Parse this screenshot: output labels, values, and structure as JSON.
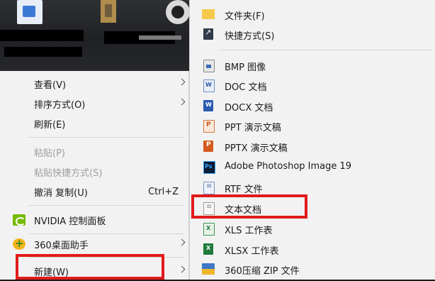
{
  "colors": {
    "menu_bg": "#f2f2f2",
    "highlight": "#e21b1b"
  },
  "desktop": {
    "icons": [
      "document-icon",
      "folder-icon",
      "music-player-icon"
    ]
  },
  "context_menu": {
    "items": [
      {
        "label": "查看(V)",
        "submenu": true
      },
      {
        "label": "排序方式(O)",
        "submenu": true
      },
      {
        "label": "刷新(E)"
      },
      {
        "label": "粘贴(P)",
        "disabled": true
      },
      {
        "label": "粘贴快捷方式(S)",
        "disabled": true
      },
      {
        "label": "撤消 复制(U)",
        "shortcut": "Ctrl+Z"
      },
      {
        "label": "NVIDIA 控制面板",
        "icon": "nvidia-icon"
      },
      {
        "label": "360桌面助手",
        "icon": "360-icon",
        "submenu": true
      },
      {
        "label": "新建(W)",
        "submenu": true,
        "highlighted": true
      }
    ]
  },
  "new_submenu": {
    "items": [
      {
        "label": "文件夹(F)",
        "icon": "folder-icon"
      },
      {
        "label": "快捷方式(S)",
        "icon": "shortcut-icon"
      },
      {
        "label": "BMP 图像",
        "icon": "bmp-file-icon"
      },
      {
        "label": "DOC 文档",
        "icon": "doc-file-icon"
      },
      {
        "label": "DOCX 文档",
        "icon": "docx-file-icon"
      },
      {
        "label": "PPT 演示文稿",
        "icon": "ppt-file-icon"
      },
      {
        "label": "PPTX 演示文稿",
        "icon": "pptx-file-icon"
      },
      {
        "label": "Adobe Photoshop Image 19",
        "icon": "photoshop-file-icon"
      },
      {
        "label": "RTF 文件",
        "icon": "rtf-file-icon"
      },
      {
        "label": "文本文档",
        "icon": "text-file-icon",
        "highlighted": true
      },
      {
        "label": "XLS 工作表",
        "icon": "xls-file-icon"
      },
      {
        "label": "XLSX 工作表",
        "icon": "xlsx-file-icon"
      },
      {
        "label": "360压缩 ZIP 文件",
        "icon": "zip-file-icon"
      }
    ]
  }
}
